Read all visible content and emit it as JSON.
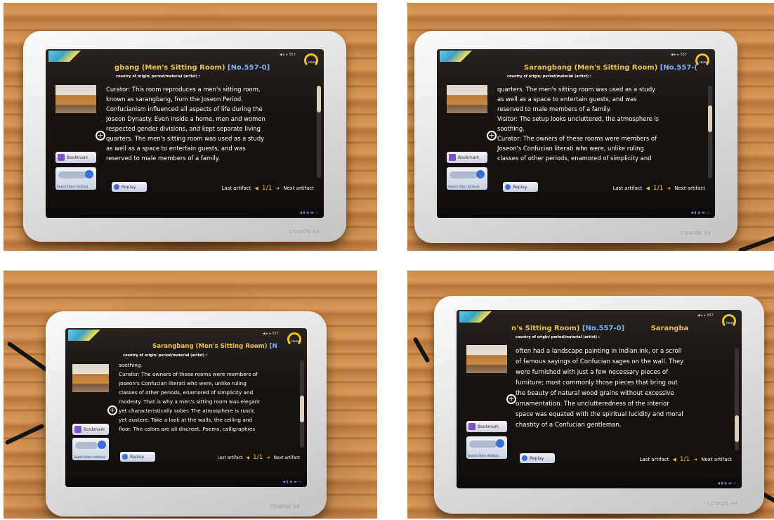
{
  "panels": [
    {
      "title": "gbang (Men's Sitting Room)",
      "number": "[No.557-0]",
      "meta": "country of origin/ period/material (artist) :",
      "lines": [
        "Curator: This room reproduces a men's sitting room,",
        "known as sarangbang, from the Joseon Period.",
        "Confucianism influenced all aspects of life during the",
        "Joseon Dynasty. Even inside a home, men and women",
        "respected gender divisions, and kept separate living",
        "quarters. The men's sitting room was used as a study",
        "as well as a space to entertain guests, and was",
        "reserved to male members of a family."
      ],
      "scroll_position": 0.0
    },
    {
      "title": "Sarangbang (Men's Sitting Room)",
      "number": "[No.557-(",
      "meta": "country of origin/ period/material (artist) :",
      "lines": [
        "quarters. The men's sitting room was used as a study",
        "as well as a space to entertain guests, and was",
        "reserved to male members of a family.",
        "Visitor: The setup looks uncluttered, the atmosphere is",
        "soothing.",
        "Curator: The owners of these rooms were members of",
        "Joseon's Confucian literati who were, unlike ruling",
        "classes of other periods, enamored of simplicity and"
      ],
      "scroll_position": 0.3
    },
    {
      "title": "Sarangbang (Men's Sitting Room)",
      "number": "[N",
      "meta": "country of origin/ period/material (artist) :",
      "lines": [
        "soothing.",
        "Curator: The owners of these rooms were members of",
        "Joseon's Confucian literati who were, unlike ruling",
        "classes of other periods, enamored of simplicity and",
        "modesty. That is why a men's sitting room was elegant",
        "yet characteristically sober. The atmosphere is rustic",
        "yet austere. Take a look at the walls, the ceiling and",
        "floor. The colors are all discreet. Poems, calligraphies"
      ],
      "scroll_position": 0.55
    },
    {
      "title": "n's Sitting Room)",
      "number": "[No.557-0]",
      "title_tail": "Sarangba",
      "meta": "country of origin/ period/material (artist) :",
      "lines": [
        "often had a landscape painting in Indian ink, or a scroll",
        "of famous sayings of Confucian sages on the wall. They",
        "were furnished with just a few necessary pieces of",
        "furniture; most commonly those pieces that bring out",
        "the beauty of natural wood grains without excessive",
        "ornamentation. The unclutteredness of the interior",
        "space was equated with the spiritual lucidity and moral",
        "chastity of a Confucian gentleman."
      ],
      "scroll_position": 0.85
    }
  ],
  "ui": {
    "bookmark": "Bookmark",
    "search_other": "Search Other Artifacts",
    "replay": "Replay",
    "last_artifact": "Last artifact",
    "page": "1/1",
    "next_artifact": "Next artifact",
    "home": "Home",
    "brand": "COWON S9"
  },
  "colors": {
    "title": "#e8c24a",
    "number": "#7ab0ff",
    "accent": "#f0c21e",
    "text": "#ffffff"
  }
}
